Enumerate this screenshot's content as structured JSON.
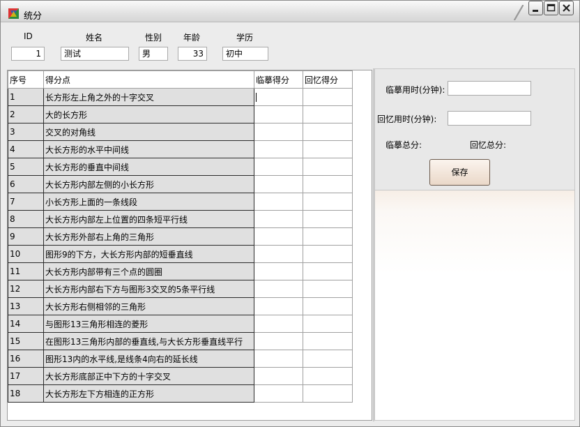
{
  "window": {
    "title": "统分"
  },
  "header": {
    "labels": {
      "id": "ID",
      "name": "姓名",
      "gender": "性别",
      "age": "年龄",
      "education": "学历"
    },
    "values": {
      "id": "1",
      "name": "测试",
      "gender": "男",
      "age": "33",
      "education": "初中"
    }
  },
  "grid": {
    "columns": [
      "序号",
      "得分点",
      "临摹得分",
      "回忆得分"
    ],
    "rows": [
      {
        "no": "1",
        "point": "长方形左上角之外的十字交叉"
      },
      {
        "no": "2",
        "point": "大的长方形"
      },
      {
        "no": "3",
        "point": "交叉的对角线"
      },
      {
        "no": "4",
        "point": "大长方形的水平中间线"
      },
      {
        "no": "5",
        "point": "大长方形的垂直中间线"
      },
      {
        "no": "6",
        "point": "大长方形内部左侧的小长方形"
      },
      {
        "no": "7",
        "point": "小长方形上面的一条线段"
      },
      {
        "no": "8",
        "point": "大长方形内部左上位置的四条短平行线"
      },
      {
        "no": "9",
        "point": "大长方形外部右上角的三角形"
      },
      {
        "no": "10",
        "point": "图形9的下方，大长方形内部的短垂直线"
      },
      {
        "no": "11",
        "point": "大长方形内部带有三个点的圆圈"
      },
      {
        "no": "12",
        "point": "大长方形内部右下方与图形3交叉的5条平行线"
      },
      {
        "no": "13",
        "point": "大长方形右侧相邻的三角形"
      },
      {
        "no": "14",
        "point": "与图形13三角形相连的菱形"
      },
      {
        "no": "15",
        "point": "在图形13三角形内部的垂直线,与大长方形垂直线平行"
      },
      {
        "no": "16",
        "point": "图形13内的水平线,是线条4向右的延长线"
      },
      {
        "no": "17",
        "point": "大长方形底部正中下方的十字交叉"
      },
      {
        "no": "18",
        "point": "大长方形左下方相连的正方形"
      }
    ]
  },
  "panel": {
    "copy_time_label": "临摹用时(分钟):",
    "recall_time_label": "回忆用时(分钟):",
    "copy_total_label": "临摹总分:",
    "recall_total_label": "回忆总分:",
    "save_label": "保存"
  }
}
